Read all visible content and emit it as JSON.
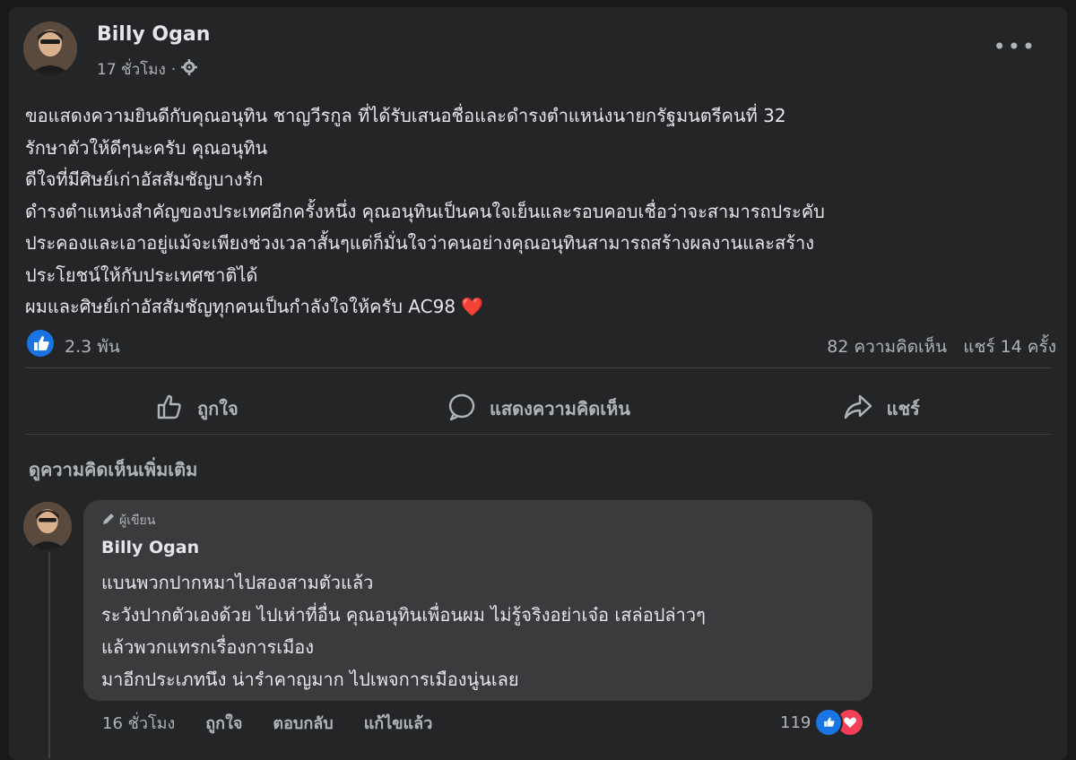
{
  "post": {
    "author": "Billy Ogan",
    "time": "17 ชั่วโมง",
    "separator": "·",
    "lines": [
      "ขอแสดงความยินดีกับคุณอนุทิน ชาญวีรกูล ที่ได้รับเสนอชื่อและดำรงตำแหน่งนายกรัฐมนตรีคนที่ 32",
      "รักษาตัวให้ดีๆนะครับ คุณอนุทิน",
      "ดีใจที่มีศิษย์เก่าอัสสัมชัญบางรัก",
      "ดำรงตำแหน่งสำคัญของประเทศอีกครั้งหนึ่ง คุณอนุทินเป็นคนใจเย็นและรอบคอบเชื่อว่าจะสามารถประคับ",
      "ประคองและเอาอยู่แม้จะเพียงช่วงเวลาสั้นๆแต่ก็มั่นใจว่าคนอย่างคุณอนุทินสามารถสร้างผลงานและสร้าง",
      "ประโยชน์ให้กับประเทศชาติได้"
    ],
    "last_line": "ผมและศิษย์เก่าอัสสัมชัญทุกคนเป็นกำลังใจให้ครับ AC98",
    "heart": "❤️"
  },
  "stats": {
    "reactions": "2.3 พัน",
    "comments": "82 ความคิดเห็น",
    "shares": "แชร์ 14 ครั้ง"
  },
  "actions": {
    "like": "ถูกใจ",
    "comment": "แสดงความคิดเห็น",
    "share": "แชร์"
  },
  "more_comments": "ดูความคิดเห็นเพิ่มเติม",
  "comment": {
    "badge": "ผู้เขียน",
    "author": "Billy Ogan",
    "lines": [
      "แบนพวกปากหมาไปสองสามตัวแล้ว",
      "ระวังปากตัวเองด้วย ไปเห่าที่อื่น คุณอนุทินเพื่อนผม ไม่รู้จริงอย่าเจ๋อ เสล่อปล่าวๆ",
      "แล้วพวกแทรกเรื่องการเมือง",
      "มาอีกประเภทนึง น่ารำคาญมาก ไปเพจการเมืองนู่นเลย"
    ],
    "time": "16 ชั่วโมง",
    "like": "ถูกใจ",
    "reply": "ตอบกลับ",
    "edited": "แก้ไขแล้ว",
    "reaction_count": "119"
  },
  "colors": {
    "background": "#18191a",
    "card": "#242526",
    "bubble": "#3a3b3c",
    "accent": "#1b74e4",
    "love": "#f33e58"
  },
  "icons": [
    "globe-settings-icon",
    "more-icon",
    "like-reaction-icon",
    "thumb-up-icon",
    "comment-icon",
    "share-icon",
    "pencil-icon",
    "love-reaction-icon"
  ]
}
